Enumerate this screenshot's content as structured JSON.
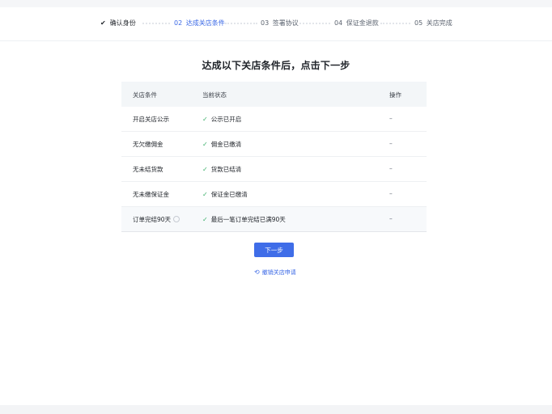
{
  "stepper": {
    "steps": [
      {
        "num": "",
        "label": "确认身份",
        "state": "done"
      },
      {
        "num": "02",
        "label": "达成关店条件",
        "state": "active"
      },
      {
        "num": "03",
        "label": "签署协议",
        "state": "todo"
      },
      {
        "num": "04",
        "label": "保证金退款",
        "state": "todo"
      },
      {
        "num": "05",
        "label": "关店完成",
        "state": "todo"
      }
    ],
    "done_icon": "check-icon"
  },
  "main": {
    "heading": "达成以下关店条件后，点击下一步",
    "table": {
      "columns": [
        "关店条件",
        "当前状态",
        "操作"
      ],
      "rows": [
        {
          "condition": "开启关店公示",
          "status": "公示已开启",
          "action": "–"
        },
        {
          "condition": "无欠缴佣金",
          "status": "佣金已缴清",
          "action": "–"
        },
        {
          "condition": "无未结货款",
          "status": "货款已结清",
          "action": "–"
        },
        {
          "condition": "无未缴保证金",
          "status": "保证金已缴清",
          "action": "–"
        },
        {
          "condition": "订单完结90天",
          "status": "最后一笔订单完结已满90天",
          "action": "–",
          "has_info_icon": true
        }
      ]
    },
    "next_button": "下一步",
    "cancel_link": "撤销关店申请"
  },
  "colors": {
    "accent": "#3f6de8",
    "success": "#3db06b",
    "header_bg": "#f3f6f8"
  }
}
